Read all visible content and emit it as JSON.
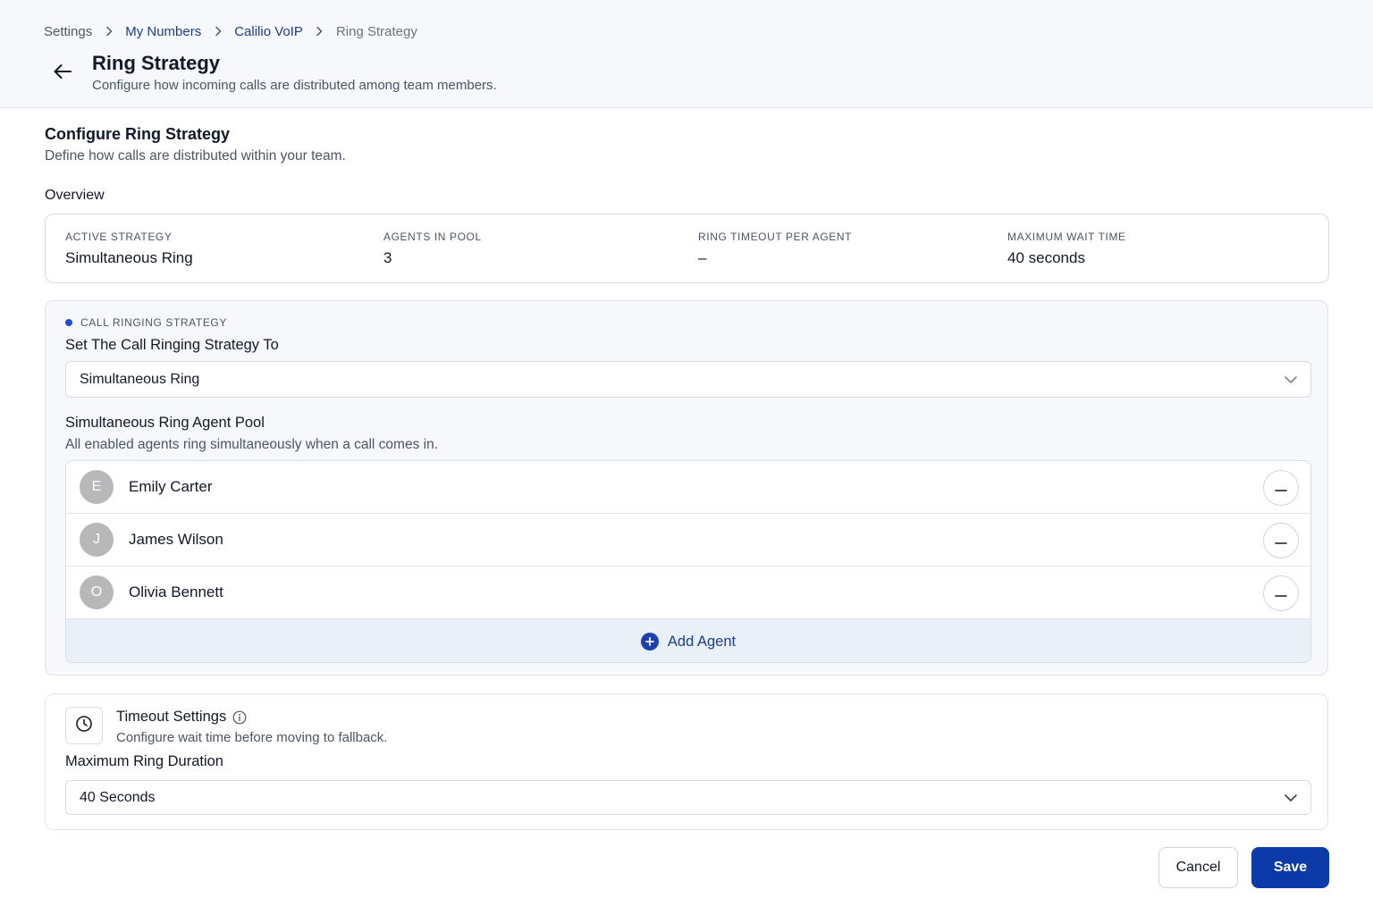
{
  "breadcrumb": {
    "items": [
      "Settings",
      "My Numbers",
      "Calilio VoIP",
      "Ring Strategy"
    ]
  },
  "header": {
    "title": "Ring Strategy",
    "subtitle": "Configure how incoming calls are distributed among team members."
  },
  "configure": {
    "title": "Configure Ring Strategy",
    "description": "Define how calls are distributed within your team.",
    "overview_label": "Overview"
  },
  "overview": {
    "active_strategy": {
      "label": "ACTIVE STRATEGY",
      "value": "Simultaneous Ring"
    },
    "agents_in_pool": {
      "label": "AGENTS IN POOL",
      "value": "3"
    },
    "ring_timeout": {
      "label": "RING TIMEOUT PER AGENT",
      "value": "–"
    },
    "max_wait": {
      "label": "MAXIMUM WAIT TIME",
      "value": "40 seconds"
    }
  },
  "strategy": {
    "eyebrow": "CALL RINGING STRATEGY",
    "select_label": "Set The Call Ringing Strategy To",
    "selected": "Simultaneous Ring",
    "pool_title": "Simultaneous Ring Agent Pool",
    "pool_description": "All enabled agents ring simultaneously when a call comes in.",
    "agents": [
      {
        "initial": "E",
        "name": "Emily Carter"
      },
      {
        "initial": "J",
        "name": "James Wilson"
      },
      {
        "initial": "O",
        "name": "Olivia Bennett"
      }
    ],
    "add_agent_label": "Add Agent"
  },
  "timeout": {
    "title": "Timeout Settings",
    "description": "Configure wait time before moving to fallback.",
    "duration_label": "Maximum Ring Duration",
    "duration_value": "40 Seconds"
  },
  "actions": {
    "cancel_label": "Cancel",
    "save_label": "Save"
  },
  "colors": {
    "accent": "#0b3aa8",
    "link": "#1e3a8a",
    "avatar": "#b8b8bb"
  },
  "icons": {
    "back": "arrow-left-icon",
    "breadcrumb_separator": "chevron-right-icon",
    "select": "chevron-down-icon",
    "remove": "minus-circle-icon",
    "add": "plus-circle-icon",
    "clock": "clock-icon",
    "info": "info-icon"
  }
}
